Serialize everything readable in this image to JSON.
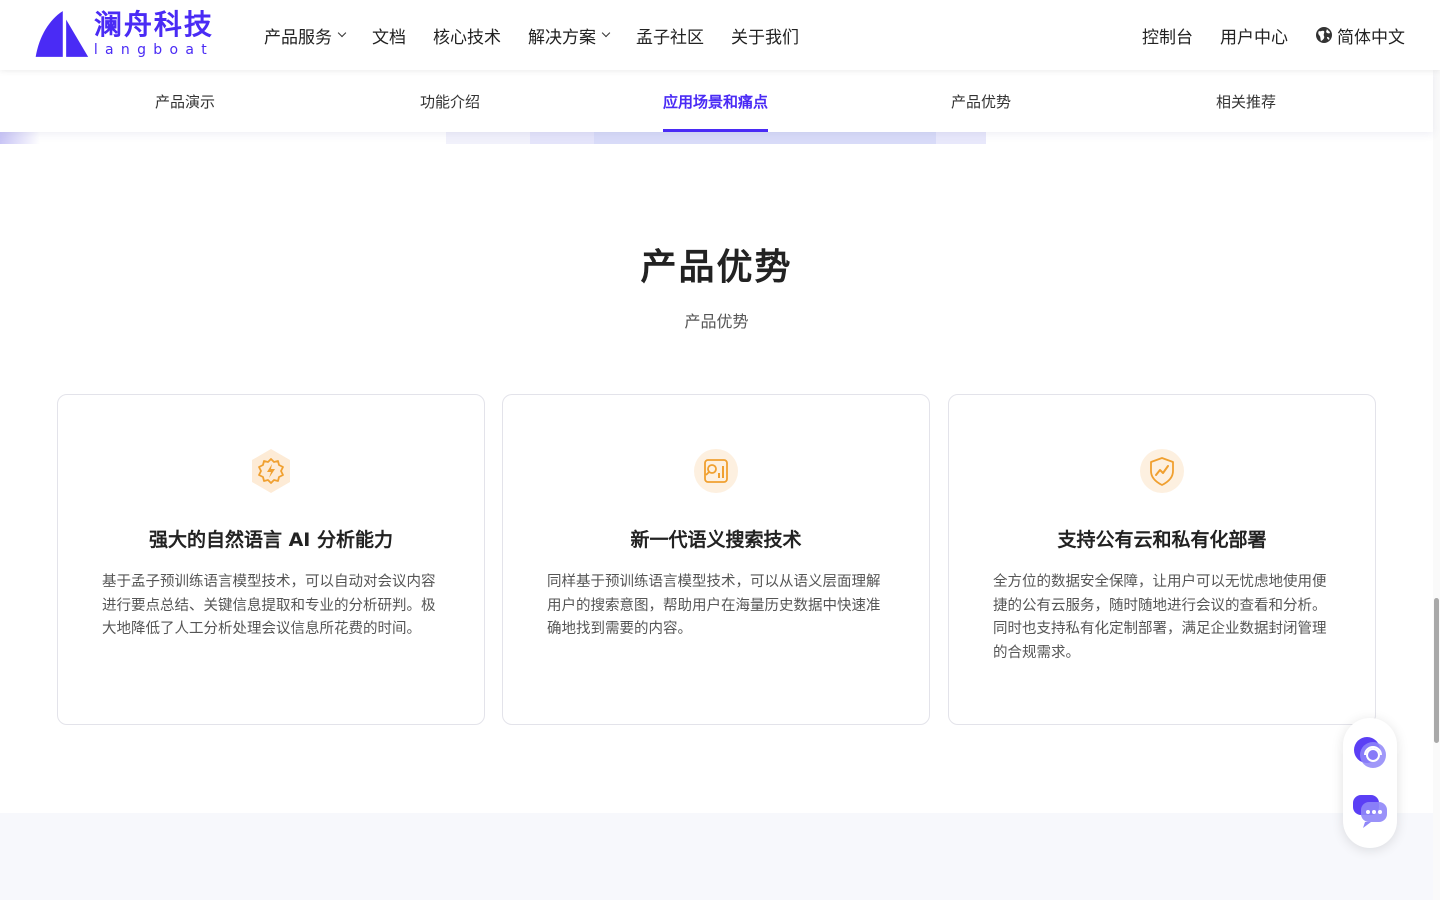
{
  "brand": {
    "name_cn": "澜舟科技",
    "name_en": "langboat",
    "accent_color": "#4a2bf5"
  },
  "topnav": {
    "items": [
      {
        "label": "产品服务",
        "has_dropdown": true
      },
      {
        "label": "文档",
        "has_dropdown": false
      },
      {
        "label": "核心技术",
        "has_dropdown": false
      },
      {
        "label": "解决方案",
        "has_dropdown": true
      },
      {
        "label": "孟子社区",
        "has_dropdown": false
      },
      {
        "label": "关于我们",
        "has_dropdown": false
      }
    ],
    "right": {
      "console": "控制台",
      "user_center": "用户中心",
      "language": "简体中文",
      "language_icon": "globe-icon"
    }
  },
  "subtabs": {
    "items": [
      {
        "label": "产品演示"
      },
      {
        "label": "功能介绍"
      },
      {
        "label": "应用场景和痛点"
      },
      {
        "label": "产品优势"
      },
      {
        "label": "相关推荐"
      }
    ],
    "active_index": 2
  },
  "section": {
    "title": "产品优势",
    "subtitle": "产品优势"
  },
  "cards": [
    {
      "icon": "lightning-gear-icon",
      "title": "强大的自然语言 AI 分析能力",
      "desc": "基于孟子预训练语言模型技术，可以自动对会议内容进行要点总结、关键信息提取和专业的分析研判。极大地降低了人工分析处理会议信息所花费的时间。"
    },
    {
      "icon": "search-chart-icon",
      "title": "新一代语义搜索技术",
      "desc": "同样基于预训练语言模型技术，可以从语义层面理解用户的搜索意图，帮助用户在海量历史数据中快速准确地找到需要的内容。"
    },
    {
      "icon": "shield-chart-icon",
      "title": "支持公有云和私有化部署",
      "desc": "全方位的数据安全保障，让用户可以无忧虑地使用便捷的公有云服务，随时随地进行会议的查看和分析。同时也支持私有化定制部署，满足企业数据封闭管理的合规需求。"
    }
  ],
  "float_widget": {
    "buttons": [
      "customer-service-icon",
      "chat-icon"
    ]
  }
}
